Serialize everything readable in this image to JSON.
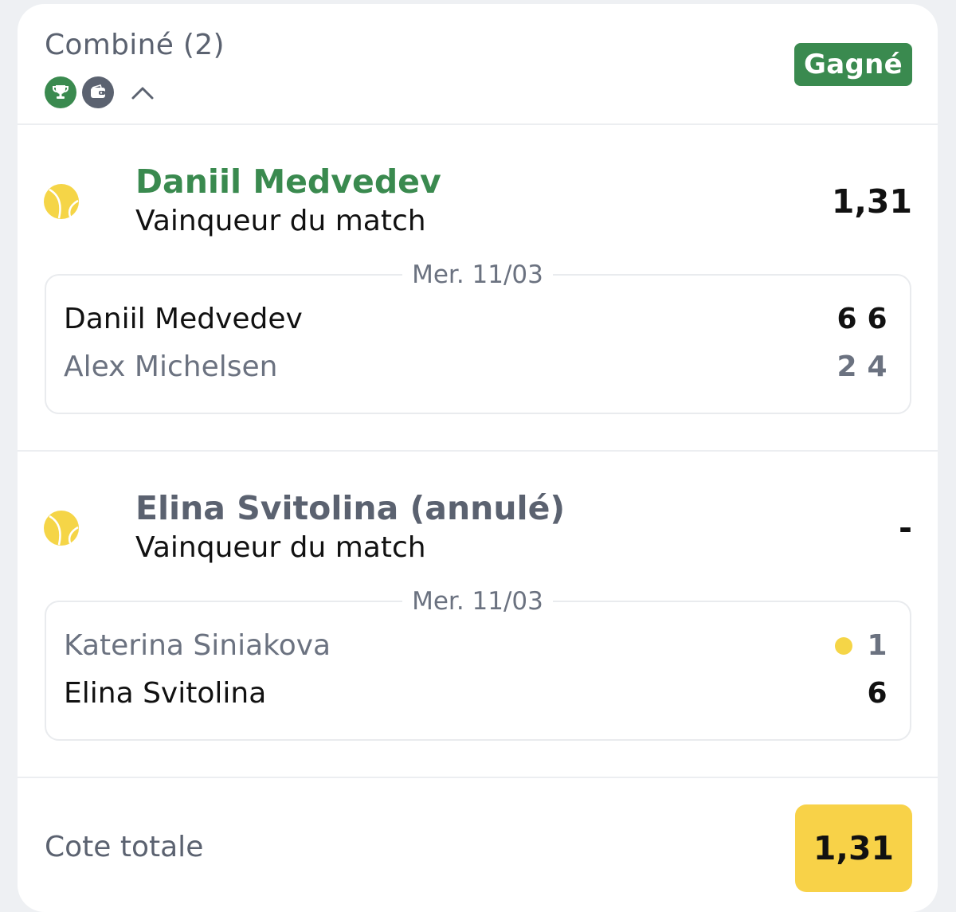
{
  "header": {
    "title": "Combiné (2)",
    "status_badge": "Gagné",
    "icons": [
      "trophy-icon",
      "wallet-icon",
      "chevron-up-icon"
    ]
  },
  "selections": [
    {
      "name": "Daniil Medvedev",
      "market": "Vainqueur du match",
      "odds": "1,31",
      "status": "won",
      "date": "Mer. 11/03",
      "players": [
        {
          "name": "Daniil Medvedev",
          "scores": [
            "6",
            "6"
          ],
          "winner": true,
          "serving": false
        },
        {
          "name": "Alex Michelsen",
          "scores": [
            "2",
            "4"
          ],
          "winner": false,
          "serving": false
        }
      ]
    },
    {
      "name": "Elina Svitolina (annulé)",
      "market": "Vainqueur du match",
      "odds": "-",
      "status": "void",
      "date": "Mer. 11/03",
      "players": [
        {
          "name": "Katerina Siniakova",
          "scores": [
            "1"
          ],
          "winner": false,
          "serving": true
        },
        {
          "name": "Elina Svitolina",
          "scores": [
            "6"
          ],
          "winner": true,
          "serving": false
        }
      ]
    }
  ],
  "footer": {
    "total_label": "Cote totale",
    "total_odds": "1,31"
  },
  "colors": {
    "accent_green": "#3a8a4f",
    "odds_yellow": "#f8d248",
    "ball_yellow": "#f5d547",
    "muted_text": "#6b7280"
  }
}
